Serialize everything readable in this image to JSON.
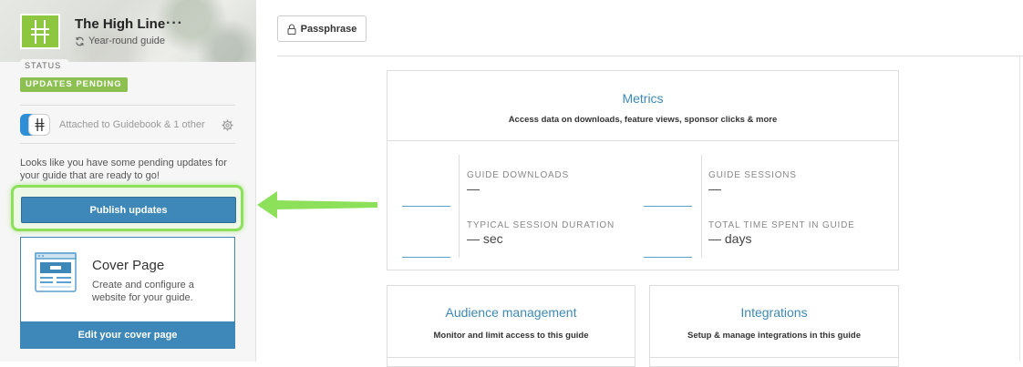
{
  "guide": {
    "title": "The High Line",
    "more": "···",
    "subtitle": "Year-round guide"
  },
  "status": {
    "label": "STATUS",
    "badge": "UPDATES PENDING",
    "badge_color": "#8cc152"
  },
  "attached": {
    "text": "Attached to Guidebook & 1 other"
  },
  "pending": {
    "message": "Looks like you have some pending updates for your guide that are ready to go!",
    "publish_label": "Publish updates"
  },
  "cover": {
    "title": "Cover Page",
    "description": "Create and configure a website for your guide.",
    "button": "Edit your cover page"
  },
  "toolbar": {
    "passphrase_label": "Passphrase"
  },
  "metrics": {
    "title": "Metrics",
    "subtitle": "Access data on downloads, feature views, sponsor clicks & more",
    "items": [
      {
        "label": "GUIDE DOWNLOADS",
        "value": "—"
      },
      {
        "label": "GUIDE SESSIONS",
        "value": "—"
      },
      {
        "label": "TYPICAL SESSION DURATION",
        "value": "— sec"
      },
      {
        "label": "TOTAL TIME SPENT IN GUIDE",
        "value": "— days"
      }
    ]
  },
  "audience": {
    "title": "Audience management",
    "subtitle": "Monitor and limit access to this guide"
  },
  "integrations": {
    "title": "Integrations",
    "subtitle": "Setup & manage integrations in this guide"
  },
  "colors": {
    "accent": "#3d88b8",
    "brand_green": "#8dc63f",
    "highlight": "#8ce05a"
  }
}
